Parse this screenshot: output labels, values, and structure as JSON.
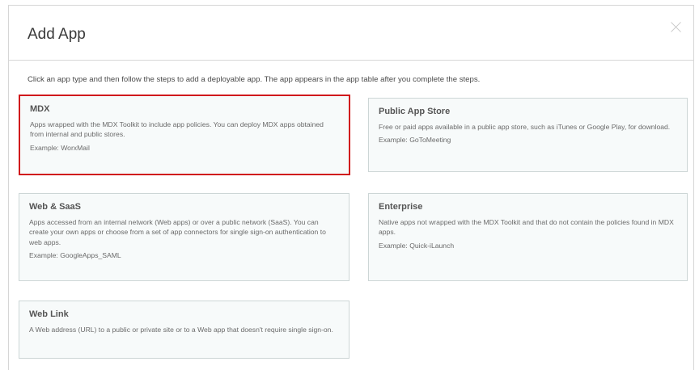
{
  "dialog": {
    "title": "Add App",
    "close_label": "×",
    "instruction": "Click an app type and then follow the steps to add a deployable app. The app appears in the app table after you complete the steps."
  },
  "cards": {
    "mdx": {
      "title": "MDX",
      "description": "Apps wrapped with the MDX Toolkit to include app policies. You can deploy MDX apps obtained from internal and public stores.",
      "example": "Example: WorxMail",
      "selected": true
    },
    "public_app_store": {
      "title": "Public App Store",
      "description": "Free or paid apps available in a public app store, such as iTunes or Google Play, for download.",
      "example": "Example: GoToMeeting"
    },
    "web_saas": {
      "title": "Web & SaaS",
      "description": "Apps accessed from an internal network (Web apps) or over a public network (SaaS). You can create your own apps or choose from a set of app connectors for single sign-on authentication to web apps.",
      "example": "Example: GoogleApps_SAML"
    },
    "enterprise": {
      "title": "Enterprise",
      "description": "Native apps not wrapped with the MDX Toolkit and that do not contain the policies found in MDX apps.",
      "example": "Example: Quick-iLaunch"
    },
    "web_link": {
      "title": "Web Link",
      "description": "A Web address (URL) to a public or private site or to a Web app that doesn't require single sign-on."
    }
  },
  "colors": {
    "selection_outline": "#d0181c",
    "card_background": "#f7fafa",
    "card_border": "#cdd6d6"
  }
}
